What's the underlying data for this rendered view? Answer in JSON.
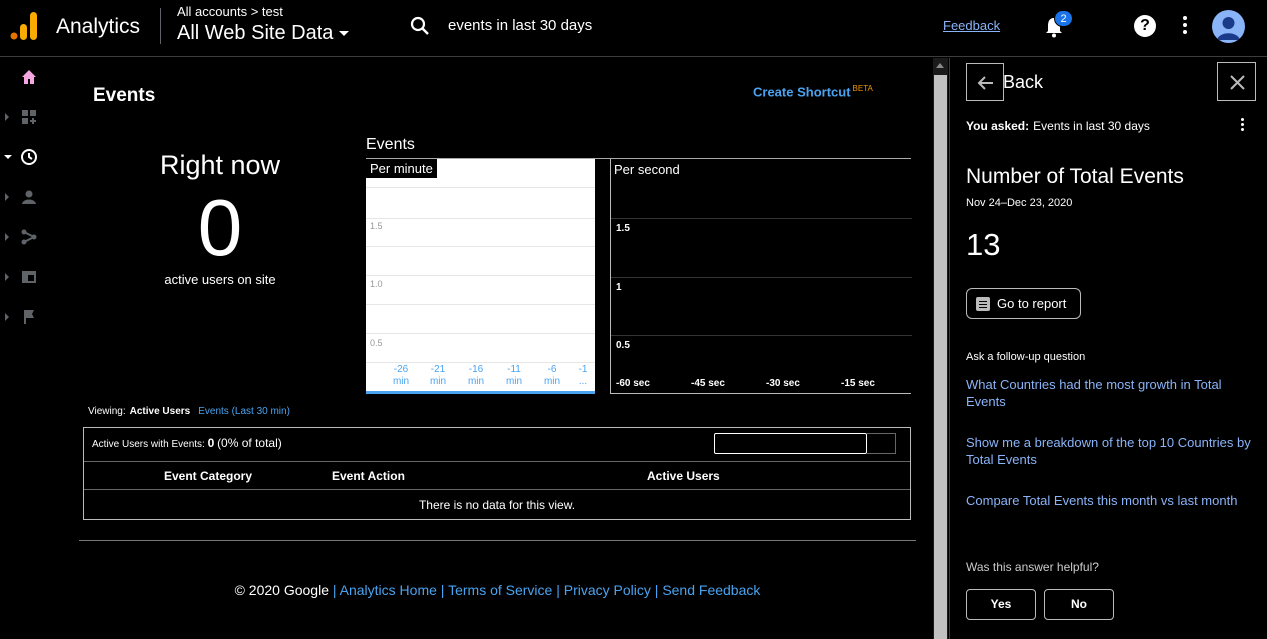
{
  "header": {
    "app_name": "Analytics",
    "crumb": "All accounts > test",
    "property": "All Web Site Data",
    "search_text": "events in last 30 days",
    "feedback": "Feedback",
    "notification_count": "2",
    "help": "?"
  },
  "rail": {
    "items": [
      "home-icon",
      "customization-icon",
      "realtime-icon",
      "audience-icon",
      "acquisition-icon",
      "behavior-icon",
      "conversions-icon"
    ]
  },
  "main": {
    "title": "Events",
    "create_shortcut": "Create Shortcut",
    "beta": "BETA",
    "right_now": "Right now",
    "active_users_count": "0",
    "active_users_label": "active users on site",
    "events_label": "Events",
    "per_minute": {
      "tab": "Per minute",
      "y_labels": [
        "1.5",
        "1.0",
        "0.5"
      ],
      "x_labels": [
        [
          "-26",
          "min"
        ],
        [
          "-21",
          "min"
        ],
        [
          "-16",
          "min"
        ],
        [
          "-11",
          "min"
        ],
        [
          "-6",
          "min"
        ],
        [
          "-1",
          "..."
        ]
      ]
    },
    "per_second": {
      "tab": "Per second",
      "y_labels": [
        "1.5",
        "1",
        "0.5"
      ],
      "x_labels": [
        "-60 sec",
        "-45 sec",
        "-30 sec",
        "-15 sec"
      ]
    },
    "viewing": {
      "label": "Viewing:",
      "active": "Active Users",
      "other": "Events (Last 30 min)"
    },
    "table": {
      "summary_prefix": "Active Users with Events:",
      "summary_value": "0",
      "summary_pct": "(0% of total)",
      "columns": [
        "Event Category",
        "Event Action",
        "Active Users"
      ],
      "empty": "There is no data for this view."
    },
    "footer": {
      "copyright": "© 2020 Google",
      "links": [
        "Analytics Home",
        "Terms of Service",
        "Privacy Policy",
        "Send Feedback"
      ]
    }
  },
  "panel": {
    "back": "Back",
    "asked_label": "You asked:",
    "asked_text": "Events in last 30 days",
    "answer_title": "Number of Total Events",
    "answer_range": "Nov 24–Dec 23, 2020",
    "answer_value": "13",
    "go_to_report": "Go to report",
    "followup_label": "Ask a follow-up question",
    "followups": [
      "What Countries had the most growth in Total Events",
      "Show me a breakdown of the top 10 Countries by Total Events",
      "Compare Total Events this month vs last month"
    ],
    "helpful_q": "Was this answer helpful?",
    "yes": "Yes",
    "no": "No"
  },
  "colors": {
    "accent": "#4aa3f0",
    "link_panel": "#8ab4f8",
    "logo_orange": "#f9ab00",
    "logo_dark": "#e37400",
    "badge": "#1a73e8"
  }
}
